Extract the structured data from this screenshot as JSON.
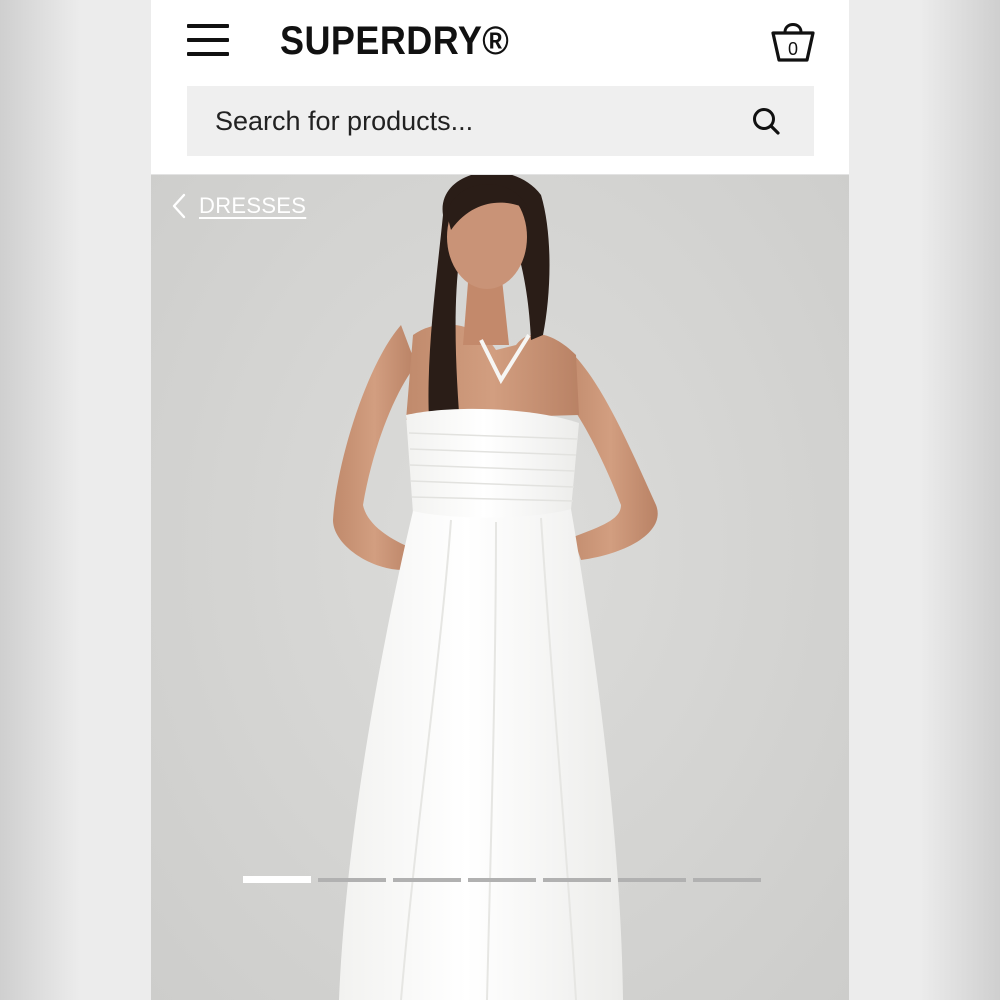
{
  "header": {
    "brand": "SUPERDRY®",
    "bag_count": "0"
  },
  "search": {
    "placeholder": "Search for products..."
  },
  "breadcrumb": {
    "label": "DRESSES"
  },
  "gallery": {
    "image_count": 7,
    "active_index": 0
  },
  "icons": {
    "menu": "hamburger-menu-icon",
    "bag": "shopping-basket-icon",
    "search": "search-icon",
    "back": "chevron-left-icon"
  },
  "colors": {
    "text": "#111111",
    "search_bg": "#efefef",
    "photo_bg": "#d6d6d4",
    "dress": "#fbfbf9"
  }
}
